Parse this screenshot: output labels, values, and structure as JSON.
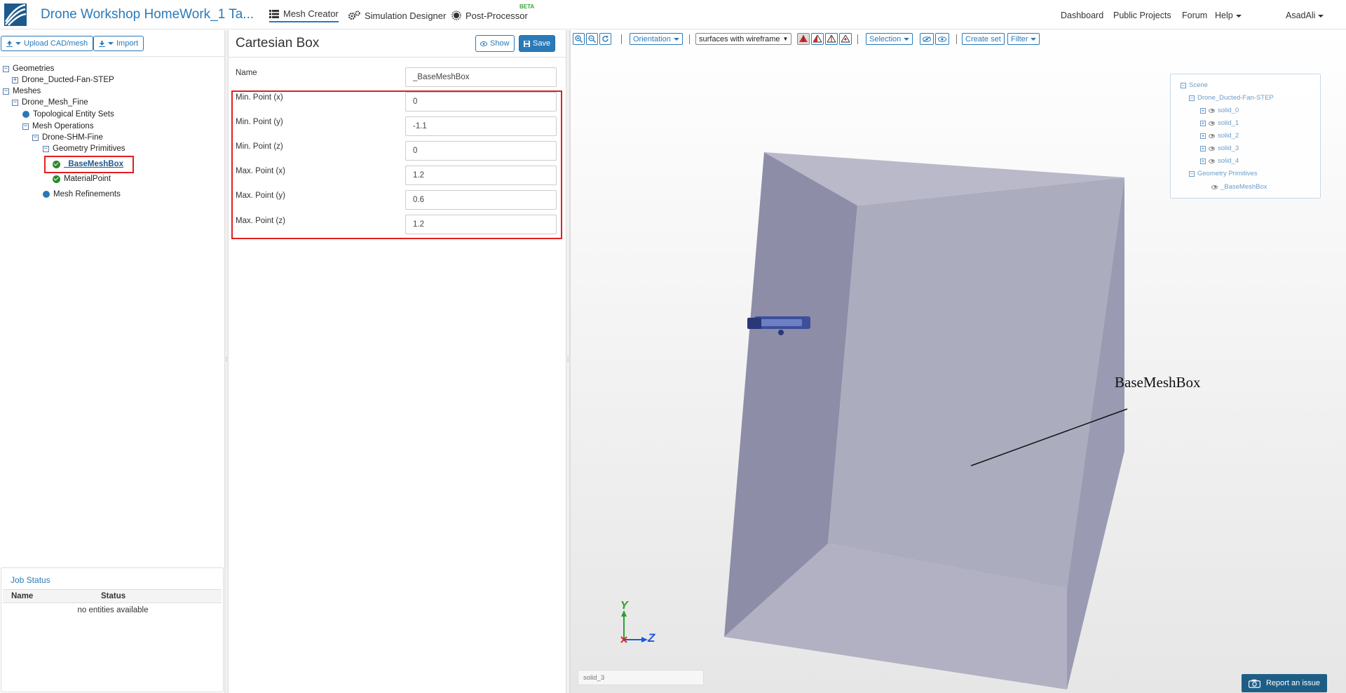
{
  "app": {
    "project_title": "Drone Workshop HomeWork_1 Ta...",
    "nav_tabs": [
      {
        "label": "Mesh Creator",
        "icon": "grid-icon"
      },
      {
        "label": "Simulation Designer",
        "icon": "gears-icon"
      },
      {
        "label": "Post-Processor",
        "icon": "sun-icon",
        "badge": "BETA"
      }
    ],
    "right_links": [
      "Dashboard",
      "Public Projects",
      "Forum",
      "Help"
    ],
    "user": "AsadAli",
    "accent_color": "#2a7ab8"
  },
  "left_panel": {
    "upload_label": "Upload CAD/mesh",
    "import_label": "Import",
    "tree": {
      "geometries": "Geometries",
      "geometry_item": "Drone_Ducted-Fan-STEP",
      "meshes": "Meshes",
      "mesh": "Drone_Mesh_Fine",
      "entity_sets": "Topological Entity Sets",
      "mesh_operations": "Mesh Operations",
      "operation": "Drone-SHM-Fine",
      "geometry_primitives": "Geometry Primitives",
      "selected_item": "_BaseMeshBox",
      "material_point": "MaterialPoint",
      "mesh_refinements": "Mesh Refinements"
    },
    "job_status": {
      "title": "Job Status",
      "col_name": "Name",
      "col_status": "Status",
      "empty": "no entities available"
    }
  },
  "editor": {
    "title": "Cartesian Box",
    "show_label": "Show",
    "save_label": "Save",
    "name_label": "Name",
    "name_value": "_BaseMeshBox",
    "fields": [
      {
        "label": "Min. Point (x)",
        "value": "0"
      },
      {
        "label": "Min. Point (y)",
        "value": "-1.1"
      },
      {
        "label": "Min. Point (z)",
        "value": "0"
      },
      {
        "label": "Max. Point (x)",
        "value": "1.2"
      },
      {
        "label": "Max. Point (y)",
        "value": "0.6"
      },
      {
        "label": "Max. Point (z)",
        "value": "1.2"
      }
    ]
  },
  "viewport": {
    "toolbar": {
      "orientation": "Orientation",
      "render_mode": "surfaces with wireframe",
      "selection": "Selection",
      "create_set": "Create set",
      "filter": "Filter"
    },
    "scene_tree": {
      "root": "Scene",
      "geometry": "Drone_Ducted-Fan-STEP",
      "solids": [
        "solid_0",
        "solid_1",
        "solid_2",
        "solid_3",
        "solid_4"
      ],
      "primitives": "Geometry Primitives",
      "primitive_item": "_BaseMeshBox"
    },
    "annotation": "BaseMeshBox",
    "axis_y": "Y",
    "axis_z": "Z",
    "bottom_input_placeholder": "solid_3",
    "report_label": "Report an issue",
    "box_color": "#a9a9be"
  }
}
